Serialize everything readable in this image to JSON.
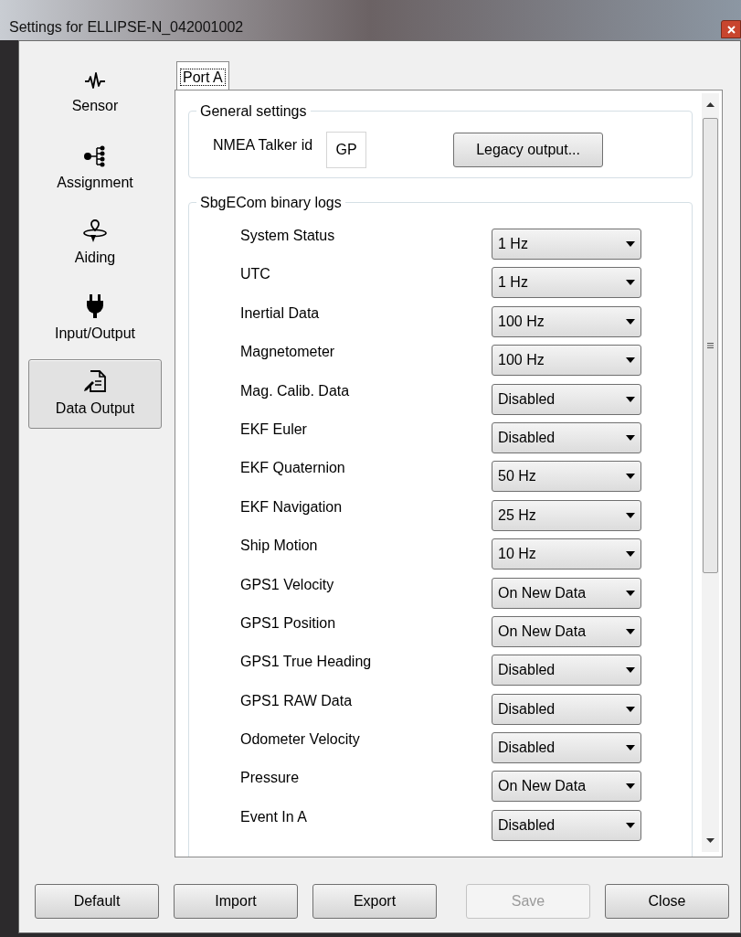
{
  "window": {
    "title": "Settings for ELLIPSE-N_042001002"
  },
  "sidebar": {
    "items": [
      {
        "label": "Sensor",
        "selected": false
      },
      {
        "label": "Assignment",
        "selected": false
      },
      {
        "label": "Aiding",
        "selected": false
      },
      {
        "label": "Input/Output",
        "selected": false
      },
      {
        "label": "Data Output",
        "selected": true
      }
    ]
  },
  "tabs": [
    {
      "label": "Port A",
      "selected": true
    }
  ],
  "general_settings": {
    "title": "General settings",
    "talker_label": "NMEA Talker id",
    "talker_value": "GP",
    "legacy_button": "Legacy output..."
  },
  "binary_logs": {
    "title": "SbgECom binary logs",
    "rows": [
      {
        "label": "System Status",
        "value": "1 Hz"
      },
      {
        "label": "UTC",
        "value": "1 Hz"
      },
      {
        "label": "Inertial Data",
        "value": "100 Hz"
      },
      {
        "label": "Magnetometer",
        "value": "100 Hz"
      },
      {
        "label": "Mag. Calib. Data",
        "value": "Disabled"
      },
      {
        "label": "EKF Euler",
        "value": "Disabled"
      },
      {
        "label": "EKF Quaternion",
        "value": "50 Hz"
      },
      {
        "label": "EKF Navigation",
        "value": "25 Hz"
      },
      {
        "label": "Ship Motion",
        "value": "10 Hz"
      },
      {
        "label": "GPS1 Velocity",
        "value": "On New Data"
      },
      {
        "label": "GPS1 Position",
        "value": "On New Data"
      },
      {
        "label": "GPS1 True Heading",
        "value": "Disabled"
      },
      {
        "label": "GPS1 RAW Data",
        "value": "Disabled"
      },
      {
        "label": "Odometer Velocity",
        "value": "Disabled"
      },
      {
        "label": "Pressure",
        "value": "On New Data"
      },
      {
        "label": "Event In A",
        "value": "Disabled"
      }
    ]
  },
  "buttons": [
    {
      "label": "Default",
      "disabled": false
    },
    {
      "label": "Import",
      "disabled": false
    },
    {
      "label": "Export",
      "disabled": false
    },
    {
      "label": "Save",
      "disabled": true
    },
    {
      "label": "Close",
      "disabled": false
    }
  ]
}
